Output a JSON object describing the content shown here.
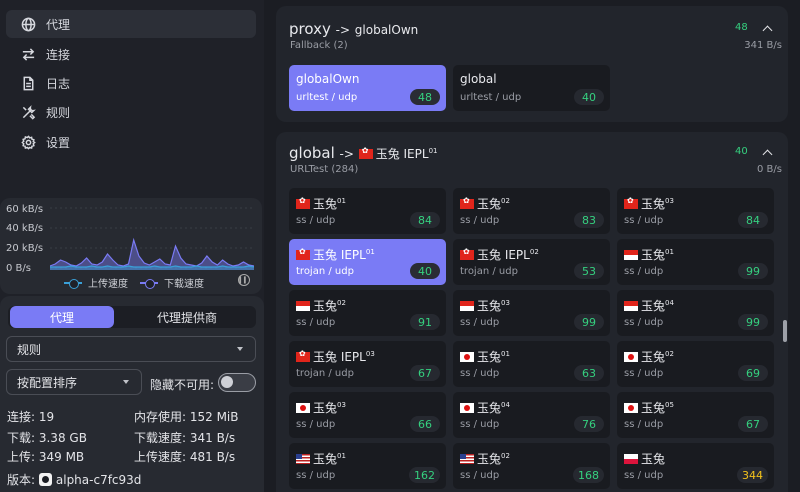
{
  "nav": [
    {
      "label": "代理",
      "icon": "globe-icon",
      "active": true
    },
    {
      "label": "连接",
      "icon": "arrows-swap-icon",
      "active": false
    },
    {
      "label": "日志",
      "icon": "document-icon",
      "active": false
    },
    {
      "label": "规则",
      "icon": "tools-icon",
      "active": false
    },
    {
      "label": "设置",
      "icon": "gear-icon",
      "active": false
    }
  ],
  "traffic": {
    "y_ticks": [
      "60 kB/s",
      "40 kB/s",
      "20 kB/s",
      "0 B/s"
    ],
    "legend_upload": "上传速度",
    "legend_download": "下载速度",
    "upload_color": "#3aa0d8",
    "download_color": "#7a7bf5"
  },
  "chart_data": {
    "type": "area",
    "ylim": [
      0,
      60
    ],
    "y_unit": "kB/s",
    "series": [
      {
        "name": "上传速度",
        "values": [
          1,
          1,
          1,
          1,
          2,
          1,
          1,
          1,
          2,
          1,
          1,
          2,
          1,
          1,
          1,
          2,
          1,
          1,
          1,
          1,
          2,
          1,
          1,
          1,
          2,
          1,
          1,
          1,
          2,
          1,
          1,
          1,
          1,
          2,
          1,
          1,
          1,
          1,
          2,
          1
        ]
      },
      {
        "name": "下载速度",
        "values": [
          2,
          4,
          8,
          6,
          3,
          2,
          5,
          10,
          4,
          3,
          6,
          14,
          8,
          3,
          2,
          4,
          28,
          12,
          5,
          3,
          6,
          9,
          4,
          3,
          22,
          10,
          4,
          3,
          2,
          5,
          12,
          6,
          3,
          8,
          4,
          2,
          3,
          6,
          3,
          2
        ]
      }
    ]
  },
  "controls": {
    "tab_proxy": "代理",
    "tab_provider": "代理提供商",
    "mode_select": "规则",
    "sort_select": "按配置排序",
    "hide_unavailable_label": "隐藏不可用:",
    "hide_unavailable": false
  },
  "stats": {
    "connections": "连接: 19",
    "memory": "内存使用: 152 MiB",
    "download_total": "下载: 3.38 GB",
    "download_speed": "下载速度: 341 B/s",
    "upload_total": "上传: 349 MB",
    "upload_speed": "上传速度: 481 B/s",
    "version_label": "版本:",
    "version": "alpha-c7fc93d"
  },
  "groups": {
    "proxy": {
      "name": "proxy",
      "arrow": "->",
      "now": "globalOwn",
      "subtitle": "Fallback (2)",
      "latency": "48",
      "speed": "341 B/s",
      "cards": [
        {
          "name": "globalOwn",
          "type": "urltest / udp",
          "delay": "48",
          "selected": true
        },
        {
          "name": "global",
          "type": "urltest / udp",
          "delay": "40",
          "selected": false
        }
      ]
    },
    "global": {
      "name": "global",
      "arrow": "->",
      "now_flag": "hk",
      "now": "玉兔 IEPL",
      "now_sup": "01",
      "subtitle": "URLTest (284)",
      "latency": "40",
      "speed": "0 B/s",
      "cards": [
        {
          "flag": "hk",
          "name": "玉兔",
          "sup": "01",
          "type": "ss / udp",
          "delay": "84",
          "selected": false
        },
        {
          "flag": "hk",
          "name": "玉兔",
          "sup": "02",
          "type": "ss / udp",
          "delay": "83",
          "selected": false
        },
        {
          "flag": "hk",
          "name": "玉兔",
          "sup": "03",
          "type": "ss / udp",
          "delay": "84",
          "selected": false
        },
        {
          "flag": "hk",
          "name": "玉兔 IEPL",
          "sup": "01",
          "type": "trojan / udp",
          "delay": "40",
          "selected": true
        },
        {
          "flag": "hk",
          "name": "玉兔 IEPL",
          "sup": "02",
          "type": "trojan / udp",
          "delay": "53",
          "selected": false
        },
        {
          "flag": "sg",
          "name": "玉兔",
          "sup": "01",
          "type": "ss / udp",
          "delay": "99",
          "selected": false
        },
        {
          "flag": "sg",
          "name": "玉兔",
          "sup": "02",
          "type": "ss / udp",
          "delay": "91",
          "selected": false
        },
        {
          "flag": "sg",
          "name": "玉兔",
          "sup": "03",
          "type": "ss / udp",
          "delay": "99",
          "selected": false
        },
        {
          "flag": "sg",
          "name": "玉兔",
          "sup": "04",
          "type": "ss / udp",
          "delay": "99",
          "selected": false
        },
        {
          "flag": "hk",
          "name": "玉兔 IEPL",
          "sup": "03",
          "type": "trojan / udp",
          "delay": "67",
          "selected": false
        },
        {
          "flag": "jp",
          "name": "玉兔",
          "sup": "01",
          "type": "ss / udp",
          "delay": "63",
          "selected": false
        },
        {
          "flag": "jp",
          "name": "玉兔",
          "sup": "02",
          "type": "ss / udp",
          "delay": "69",
          "selected": false
        },
        {
          "flag": "jp",
          "name": "玉兔",
          "sup": "03",
          "type": "ss / udp",
          "delay": "66",
          "selected": false
        },
        {
          "flag": "jp",
          "name": "玉兔",
          "sup": "04",
          "type": "ss / udp",
          "delay": "76",
          "selected": false
        },
        {
          "flag": "jp",
          "name": "玉兔",
          "sup": "05",
          "type": "ss / udp",
          "delay": "67",
          "selected": false
        },
        {
          "flag": "us",
          "name": "玉兔",
          "sup": "01",
          "type": "ss / udp",
          "delay": "162",
          "selected": false
        },
        {
          "flag": "us",
          "name": "玉兔",
          "sup": "02",
          "type": "ss / udp",
          "delay": "168",
          "selected": false
        },
        {
          "flag": "pl",
          "name": "玉兔",
          "sup": "",
          "type": "ss / udp",
          "delay": "344",
          "selected": false,
          "warn": true
        }
      ]
    }
  }
}
